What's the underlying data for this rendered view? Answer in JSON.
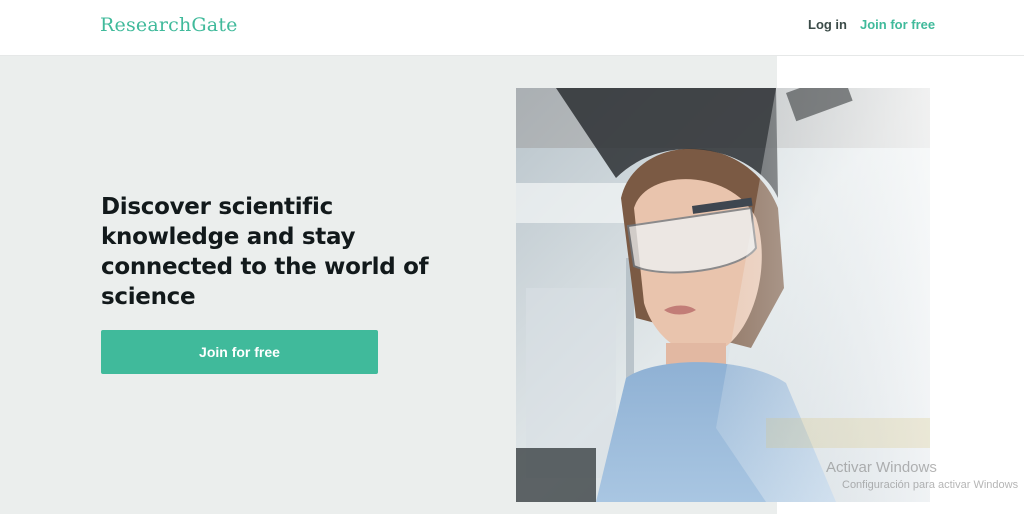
{
  "header": {
    "logo": "ResearchGate",
    "login_label": "Log in",
    "join_label": "Join for free"
  },
  "hero": {
    "headline": "Discover scientific knowledge and stay connected to the world of science",
    "cta_label": "Join for free"
  },
  "watermark": {
    "title": "Activar Windows",
    "subtitle": "Configuración para activar Windows"
  },
  "colors": {
    "brand": "#40ba9b",
    "hero_bg": "#ebeeed",
    "headline": "#12191b"
  }
}
